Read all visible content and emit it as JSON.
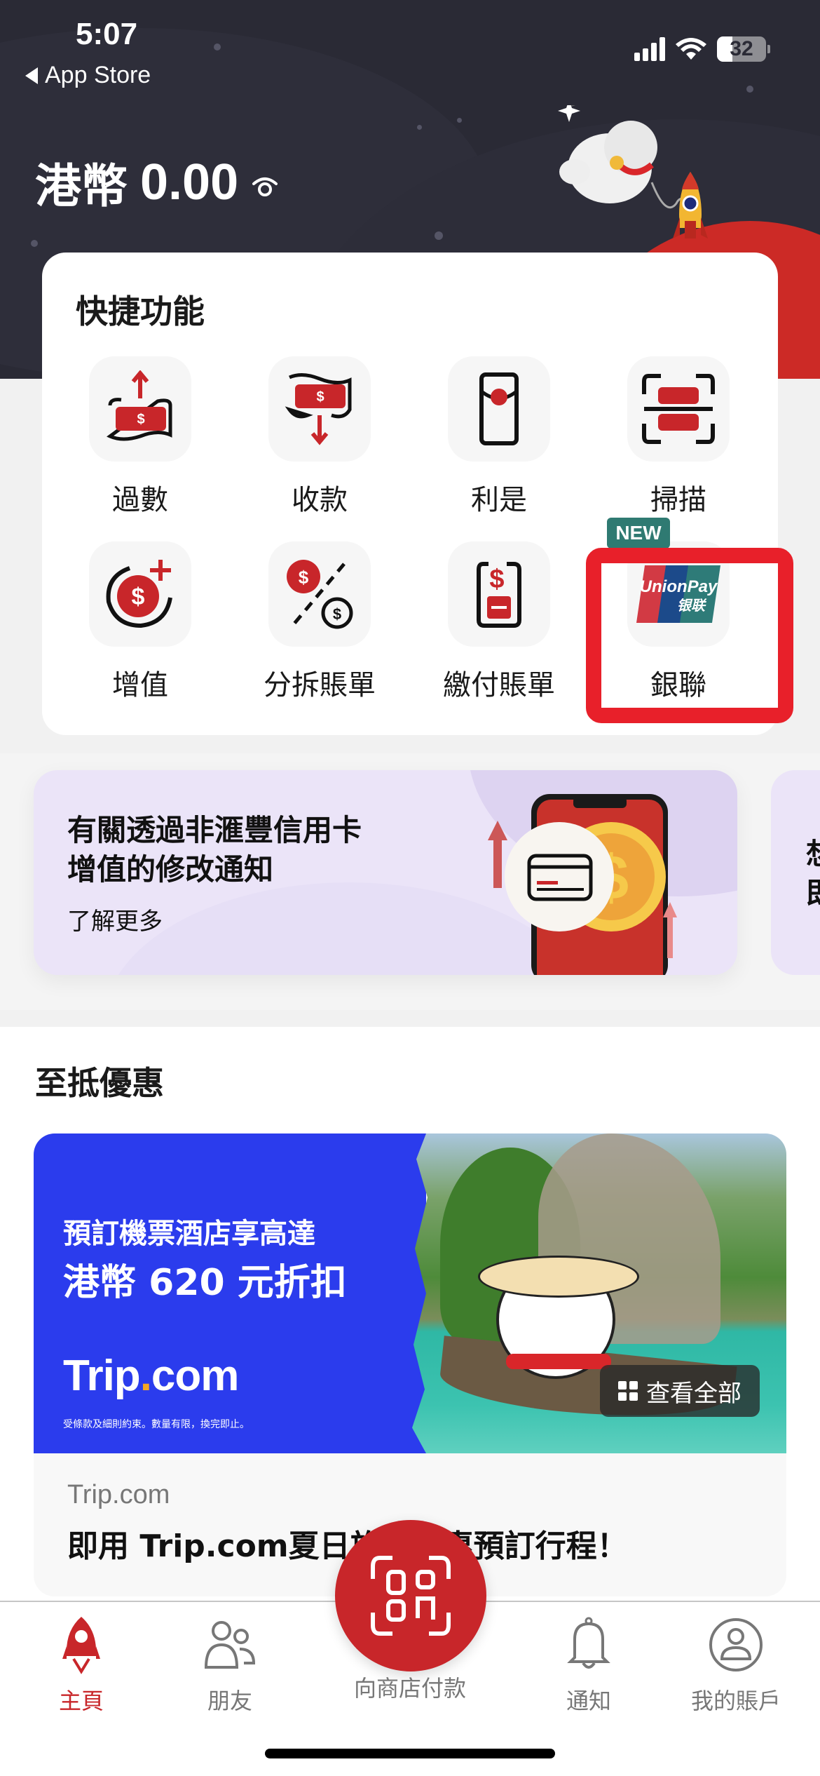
{
  "status_bar": {
    "time": "5:07",
    "back_label": "App Store",
    "battery_level": "32",
    "battery_percent": 32
  },
  "header": {
    "currency": "港幣",
    "balance": "0.00"
  },
  "quick_functions": {
    "title": "快捷功能",
    "items": [
      {
        "label": "過數",
        "icon": "send-money-icon"
      },
      {
        "label": "收款",
        "icon": "receive-money-icon"
      },
      {
        "label": "利是",
        "icon": "red-packet-icon"
      },
      {
        "label": "掃描",
        "icon": "scan-icon"
      },
      {
        "label": "增值",
        "icon": "top-up-icon"
      },
      {
        "label": "分拆賬單",
        "icon": "split-bill-icon"
      },
      {
        "label": "繳付賬單",
        "icon": "pay-bill-icon"
      },
      {
        "label": "銀聯",
        "icon": "unionpay-icon",
        "badge": "NEW",
        "highlighted": true
      }
    ],
    "unionpay_logo_text": "UnionPay",
    "unionpay_logo_cn": "银联"
  },
  "promos": [
    {
      "title_line1": "有關透過非滙豐信用卡",
      "title_line2": "增值的修改通知",
      "link": "了解更多"
    },
    {
      "title_line1": "想",
      "title_line2": "即"
    }
  ],
  "offers": {
    "title": "至抵優惠",
    "card": {
      "headline_line1": "預訂機票酒店享高達",
      "headline_line2": "港幣 620 元折扣",
      "brand_main": "Trip",
      "brand_dot": ".",
      "brand_suffix": "com",
      "terms": "受條款及細則約束。數量有限，換完即止。",
      "view_all": "查看全部",
      "merchant": "Trip.com",
      "description": "即用 Trip.com夏日旅遊優惠預訂行程！"
    }
  },
  "tabbar": {
    "items": [
      {
        "label": "主頁",
        "active": true
      },
      {
        "label": "朋友",
        "active": false
      },
      {
        "label": "向商店付款",
        "active": false
      },
      {
        "label": "通知",
        "active": false
      },
      {
        "label": "我的賬戶",
        "active": false
      }
    ]
  },
  "colors": {
    "brand_red": "#c8262a",
    "header_bg": "#2a2a35",
    "highlight_red": "#e8202a",
    "new_badge": "#2f7a72",
    "trip_blue": "#2b3ced"
  }
}
